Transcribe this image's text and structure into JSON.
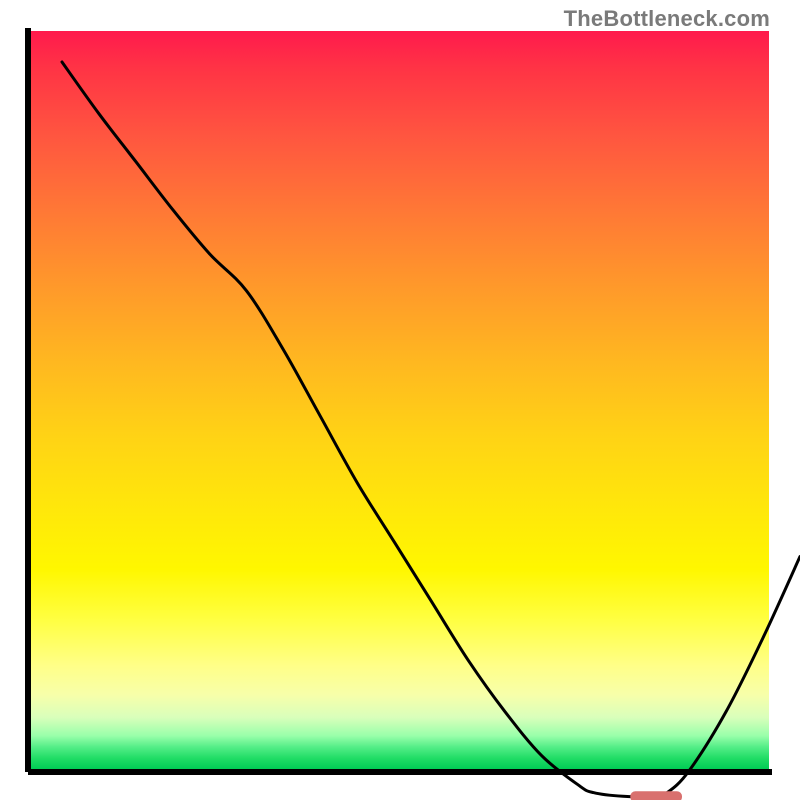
{
  "watermark": "TheBottleneck.com",
  "chart_data": {
    "type": "line",
    "title": "",
    "xlabel": "",
    "ylabel": "",
    "xlim": [
      0,
      100
    ],
    "ylim": [
      0,
      100
    ],
    "x": [
      0,
      5,
      10,
      15,
      20,
      25,
      30,
      35,
      40,
      45,
      50,
      55,
      60,
      65,
      70,
      72,
      76,
      80,
      82,
      85,
      90,
      95,
      100
    ],
    "y": [
      100,
      93,
      86.5,
      80,
      74,
      69,
      61,
      52,
      43,
      35,
      27,
      19,
      12,
      6,
      2,
      1,
      0.5,
      0.5,
      1,
      4,
      12,
      22,
      33
    ],
    "marker_segment": {
      "x_start": 77,
      "x_end": 84,
      "y": 0.5
    },
    "background_gradient": {
      "top_color": "#ff1a4d",
      "bottom_color": "#00cc55",
      "stops": [
        "red",
        "orange",
        "yellow",
        "pale-yellow",
        "pale-green",
        "green"
      ]
    },
    "curve_stroke": "#000000",
    "curve_width": 3,
    "marker_color": "#d9706e"
  }
}
